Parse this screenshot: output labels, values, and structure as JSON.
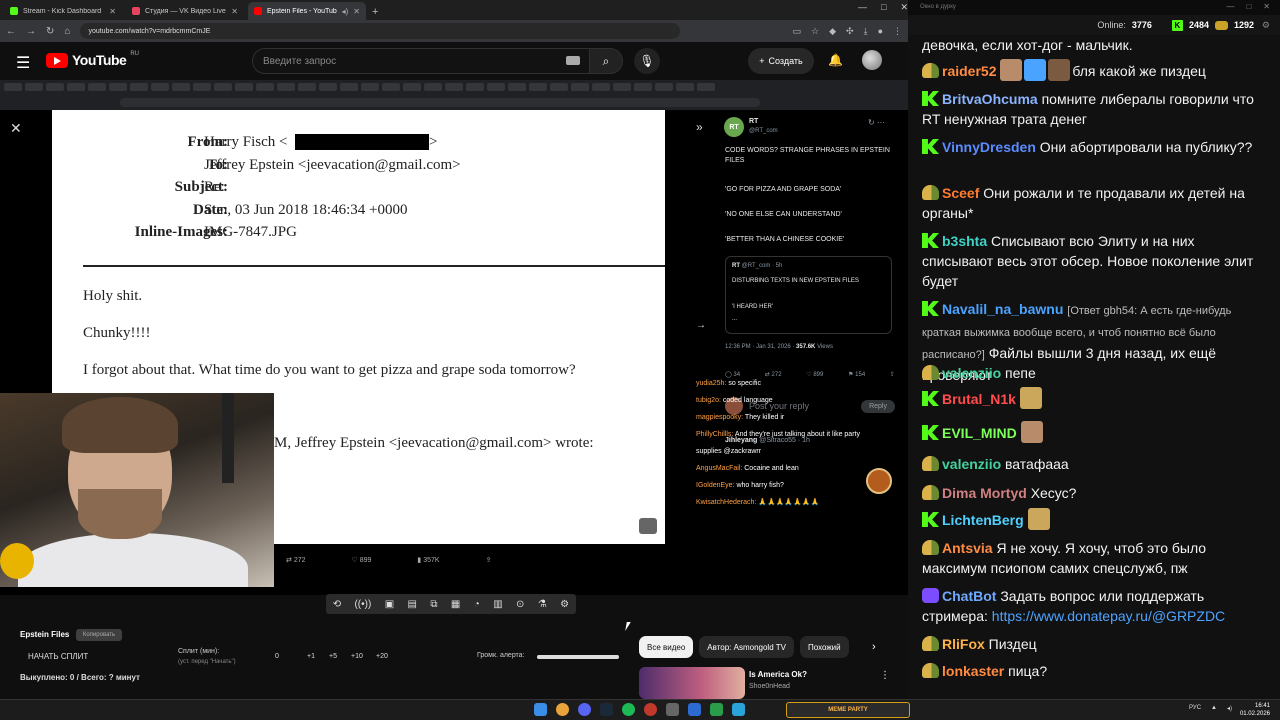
{
  "browser": {
    "tabs": [
      {
        "title": "Stream - Kick Dashboard",
        "color": "#53fc18",
        "active": false
      },
      {
        "title": "Студия — VK Видео Live",
        "color": "#e4445e",
        "active": false
      },
      {
        "title": "Epstein Files - YouTube",
        "color": "#ff0000",
        "active": true
      }
    ],
    "url": "youtube.com/watch?v=mdrbcmmCmJE"
  },
  "youtube": {
    "logo_text": "YouTube",
    "logo_region": "RU",
    "search_placeholder": "Введите запрос",
    "create_label": "Создать"
  },
  "email_doc": {
    "from_label": "From:",
    "from_value": "Harry Fisch <",
    "from_tail": ">",
    "to_label": "To:",
    "to_value": "Jeffrey Epstein <jeevacation@gmail.com>",
    "subject_label": "Subject:",
    "subject_value": "Re:",
    "date_label": "Date:",
    "date_value": "Sun, 03 Jun 2018 18:46:34 +0000",
    "images_label": "Inline-Images:",
    "images_value": "IMG-7847.JPG",
    "body": [
      "Holy shit.",
      "Chunky!!!!",
      "I forgot about that. What time do you want to get pizza and grape soda tomorrow?"
    ],
    "quoted": "M, Jeffrey Epstein <jeevacation@gmail.com> wrote:"
  },
  "tweet_stats_bar": {
    "retweets": "272",
    "likes": "899",
    "views": "357K"
  },
  "tweet": {
    "name": "RT",
    "handle": "@RT_com",
    "lines": [
      "CODE WORDS? STRANGE PHRASES IN EPSTEIN FILES",
      "'GO FOR PIZZA AND GRAPE SODA'",
      "'NO ONE ELSE CAN UNDERSTAND'",
      "'BETTER THAN A CHINESE COOKIE'"
    ],
    "quote_name": "RT",
    "quote_handle": "@RT_com · 5h",
    "quote_lines": [
      "DISTURBING TEXTS IN NEW EPSTEIN FILES",
      "'I HEARD HER'",
      "..."
    ],
    "time": "12:36 PM · Jan 31, 2026 ·",
    "views_count": "357.6K",
    "views_label": "Views",
    "replies": "34",
    "retweets": "272",
    "likes": "899",
    "bookmarks": "154",
    "reply_placeholder": "Post your reply",
    "reply_button": "Reply",
    "next_user": "Jihleyang",
    "next_handle": "@Sitraco55 · 1h"
  },
  "overlay_chat": [
    {
      "user": "yudia25h:",
      "msg": "so specific"
    },
    {
      "user": "tubig2o:",
      "msg": "coded language"
    },
    {
      "user": "magpiespooky:",
      "msg": "They killed ir"
    },
    {
      "user": "PhillyChillls:",
      "msg": "And they're just talking about it like party"
    },
    {
      "user": "",
      "msg": "supplies @zackrawrr"
    },
    {
      "user": "AngusMacFail:",
      "msg": "Cocaine and lean"
    },
    {
      "user": "IGoldenEye:",
      "msg": "who harry fish?"
    },
    {
      "user": "KwisatchHederach:",
      "msg": "🙏🙏🙏🙏🙏🙏🙏"
    }
  ],
  "below_video": {
    "title": "Epstein Files",
    "copy_label": "Копировать",
    "split_button": "НАЧАТЬ СПЛИТ",
    "split_label": "Сплит (мин):",
    "split_hint": "(уст. перед \"Начать\")",
    "split_values": [
      "0",
      "+1",
      "+5",
      "+10",
      "+20"
    ],
    "volume_label": "Громк. алерта:",
    "volume_level": 1.0,
    "bought_text": "Выкуплено: 0 / Всего: ? минут",
    "chips": [
      "Все видео",
      "Автор: Asmongold TV",
      "Похожий"
    ],
    "rec_title": "Is America Ok?",
    "rec_channel": "Shoe0nHead"
  },
  "chat_window": {
    "title": "Окно в дурку",
    "online_label": "Online:",
    "online_count": "3776",
    "kick_count": "2484",
    "other_count": "1292",
    "messages": [
      {
        "badge": "none",
        "user": "",
        "color": "#ffffff",
        "text": "девочка, если хот-дог - мальчик.",
        "emotes": 0,
        "link": "",
        "reply": ""
      },
      {
        "badge": "gl",
        "user": "raider52",
        "color": "#ff8c42",
        "text": "бля какой же пиздец",
        "emotes": 3,
        "link": "",
        "reply": ""
      },
      {
        "badge": "k",
        "user": "BritvaOhcuma",
        "color": "#8ab4ff",
        "text": "помните либералы говорили что RT ненужная трата денег",
        "emotes": 0,
        "link": "",
        "reply": ""
      },
      {
        "badge": "k",
        "user": "VinnyDresden",
        "color": "#5b8cff",
        "text": "Они абортировали на публику??",
        "emotes": 0,
        "link": "",
        "reply": ""
      },
      {
        "badge": "gl",
        "user": "Sceef",
        "color": "#ff7b2e",
        "text": "Они рожали и те продавали их детей на органы*",
        "emotes": 0,
        "link": "",
        "reply": ""
      },
      {
        "badge": "k",
        "user": "b3shta",
        "color": "#3ed3c5",
        "text": "Списывают всю Элиту и на них списывают весь этот обсер. Новое поколение элит будет",
        "emotes": 0,
        "link": "",
        "reply": ""
      },
      {
        "badge": "k",
        "user": "Navalil_na_bawnu",
        "color": "#4aa3ff",
        "text": "Файлы вышли 3 дня назад, их ещё проверяют",
        "emotes": 0,
        "link": "",
        "reply": "[Ответ gbh54: А есть где-нибудь краткая выжимка вообще всего, и чтоб понятно всё было расписано?]"
      },
      {
        "badge": "gl",
        "user": "valenziio",
        "color": "#42d29d",
        "text": "пепе",
        "emotes": 0,
        "link": "",
        "reply": ""
      },
      {
        "badge": "k",
        "user": "Brutal_N1k",
        "color": "#ff4d4d",
        "text": "",
        "emotes": 1,
        "link": "",
        "reply": ""
      },
      {
        "badge": "k",
        "user": "EVIL_MIND",
        "color": "#7dff5a",
        "text": "",
        "emotes": 1,
        "link": "",
        "reply": ""
      },
      {
        "badge": "gl",
        "user": "valenziio",
        "color": "#42d29d",
        "text": "ватафааа",
        "emotes": 0,
        "link": "",
        "reply": ""
      },
      {
        "badge": "gl",
        "user": "Dima Mortyd",
        "color": "#d08080",
        "text": "Хесус?",
        "emotes": 0,
        "link": "",
        "reply": ""
      },
      {
        "badge": "k",
        "user": "LichtenBerg",
        "color": "#4fd0ff",
        "text": "",
        "emotes": 1,
        "link": "",
        "reply": ""
      },
      {
        "badge": "gl",
        "user": "Antsvia",
        "color": "#ff8c42",
        "text": "Я не хочу. Я хочу, чтоб это было максимум псиопом самих спецслужб, пж",
        "emotes": 0,
        "link": "",
        "reply": ""
      },
      {
        "badge": "pp",
        "user": "ChatBot",
        "color": "#6fa8ff",
        "text": "Задать вопрос или поддержать стримера:",
        "emotes": 0,
        "link": "https://www.donatepay.ru/@GRPZDC",
        "reply": ""
      },
      {
        "badge": "gl",
        "user": "RliFox",
        "color": "#ffb347",
        "text": "Пиздец",
        "emotes": 0,
        "link": "",
        "reply": ""
      },
      {
        "badge": "gl",
        "user": "lonkaster",
        "color": "#ff8c42",
        "text": "пица?",
        "emotes": 0,
        "link": "",
        "reply": ""
      }
    ]
  },
  "taskbar": {
    "widget_label": "MEME PARTY",
    "lang": "РУС",
    "time": "16:41",
    "date": "01.02.2026"
  }
}
